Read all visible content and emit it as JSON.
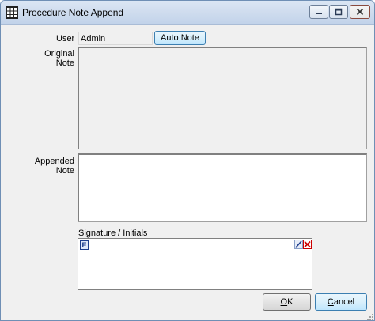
{
  "window": {
    "title": "Procedure Note Append"
  },
  "form": {
    "user_label": "User",
    "user_value": "Admin",
    "auto_note_label": "Auto Note",
    "original_note_label": "Original Note",
    "original_note_value": "",
    "appended_note_label": "Appended Note",
    "appended_note_value": "",
    "signature_label": "Signature / Initials",
    "signature_mode_badge": "E"
  },
  "buttons": {
    "ok_access_key": "O",
    "ok_rest": "K",
    "cancel_access_key": "C",
    "cancel_rest": "ancel"
  },
  "colors": {
    "window_bg": "#f0f0f0",
    "titlebar": "#cfdcee",
    "clear_icon": "#cc0000",
    "pen_icon": "#1c3c8c"
  },
  "icons": {
    "title": "grid-icon",
    "minimize": "minimize-icon",
    "maximize": "maximize-icon",
    "close": "close-icon",
    "signature_pen": "pen-icon",
    "signature_clear": "clear-x-icon"
  }
}
